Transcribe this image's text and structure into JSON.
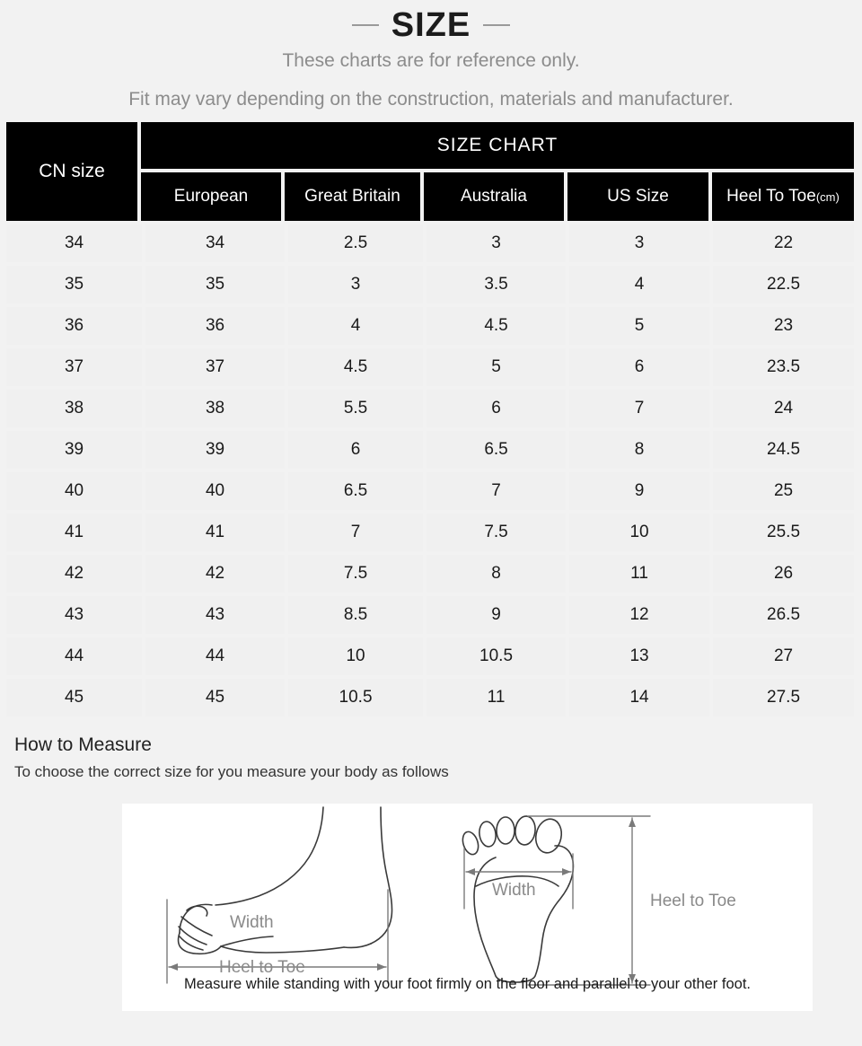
{
  "header": {
    "title": "SIZE",
    "subtitle_1": "These charts are for reference only.",
    "subtitle_2": "Fit may vary depending on the construction, materials and manufacturer."
  },
  "table": {
    "cn_header": "CN size",
    "chart_title": "SIZE CHART",
    "columns": [
      "European",
      "Great Britain",
      "Australia",
      "US Size",
      "Heel To Toe"
    ],
    "heel_unit": "(cm)",
    "rows": [
      [
        "34",
        "34",
        "2.5",
        "3",
        "3",
        "22"
      ],
      [
        "35",
        "35",
        "3",
        "3.5",
        "4",
        "22.5"
      ],
      [
        "36",
        "36",
        "4",
        "4.5",
        "5",
        "23"
      ],
      [
        "37",
        "37",
        "4.5",
        "5",
        "6",
        "23.5"
      ],
      [
        "38",
        "38",
        "5.5",
        "6",
        "7",
        "24"
      ],
      [
        "39",
        "39",
        "6",
        "6.5",
        "8",
        "24.5"
      ],
      [
        "40",
        "40",
        "6.5",
        "7",
        "9",
        "25"
      ],
      [
        "41",
        "41",
        "7",
        "7.5",
        "10",
        "25.5"
      ],
      [
        "42",
        "42",
        "7.5",
        "8",
        "11",
        "26"
      ],
      [
        "43",
        "43",
        "8.5",
        "9",
        "12",
        "26.5"
      ],
      [
        "44",
        "44",
        "10",
        "10.5",
        "13",
        "27"
      ],
      [
        "45",
        "45",
        "10.5",
        "11",
        "14",
        "27.5"
      ]
    ]
  },
  "measure": {
    "heading": "How to Measure",
    "intro": "To choose the correct size for you measure your body as follows",
    "side_width_label": "Width",
    "side_heel_label": "Heel to Toe",
    "sole_width_label": "Width",
    "sole_heel_label": "Heel to Toe",
    "caption": "Measure while standing with your foot firmly on the floor and parallel to your other foot."
  },
  "colors": {
    "page_background": "#f2f2f2",
    "header_background": "#000000",
    "header_text": "#ffffff",
    "cell_background": "#f0f0f0",
    "cell_text": "#1a1a1a",
    "subtitle_text": "#8c8c8c",
    "diagram_line": "#3a3a3a",
    "diagram_label": "#8a8a8a",
    "panel_background": "#ffffff"
  }
}
